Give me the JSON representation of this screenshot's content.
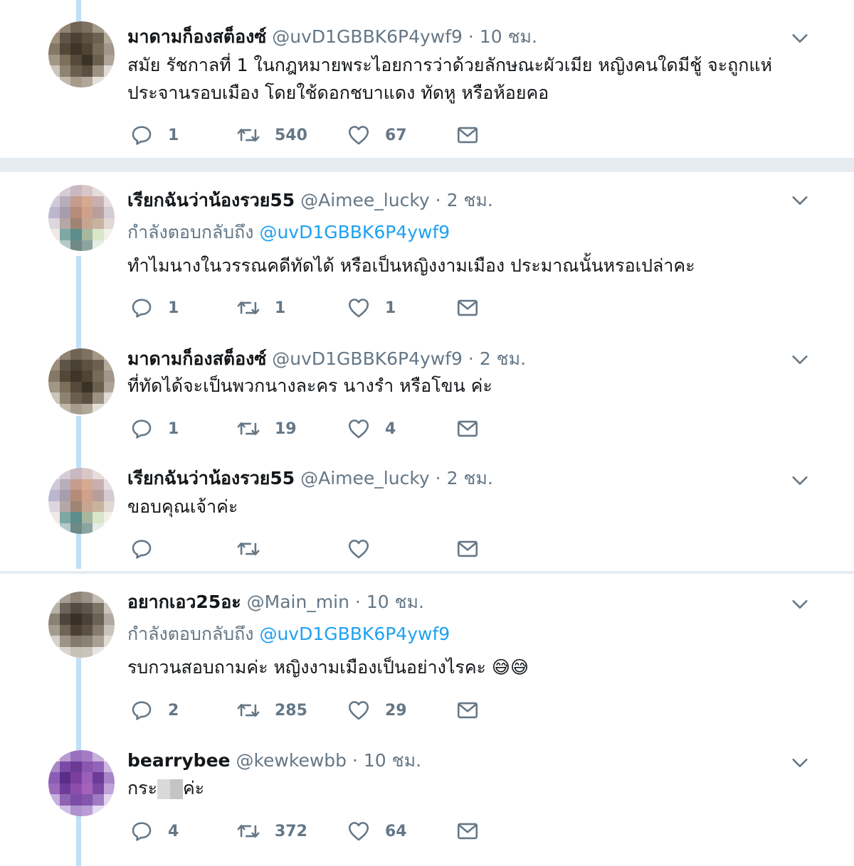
{
  "tweets": [
    {
      "name": "มาดามก็องสต็องซ์",
      "handle": "@uvD1GBBK6P4ywf9",
      "time": "10 ชม.",
      "text": "สมัย รัชกาลที่ 1 ในกฎหมายพระไอยการว่าด้วยลักษณะผัวเมีย หญิงคนใดมีชู้ จะถูกแห่ประจานรอบเมือง โดยใช้ดอกชบาแดง ทัดหู หรือห้อยคอ",
      "replies": "1",
      "retweets": "540",
      "likes": "67"
    },
    {
      "name": "เรียกฉันว่าน้องรวย55",
      "handle": "@Aimee_lucky",
      "time": "2 ชม.",
      "replying_label": "กำลังตอบกลับถึง",
      "replying_to": "@uvD1GBBK6P4ywf9",
      "text": "ทำไมนางในวรรณคดีทัดได้  หรือเป็นหญิงงามเมือง ประมาณนั้นหรอเปล่าคะ",
      "replies": "1",
      "retweets": "1",
      "likes": "1"
    },
    {
      "name": "มาดามก็องสต็องซ์",
      "handle": "@uvD1GBBK6P4ywf9",
      "time": "2 ชม.",
      "text": "ที่ทัดได้จะเป็นพวกนางละคร นางรำ หรือโขน ค่ะ",
      "replies": "1",
      "retweets": "19",
      "likes": "4"
    },
    {
      "name": "เรียกฉันว่าน้องรวย55",
      "handle": "@Aimee_lucky",
      "time": "2 ชม.",
      "text": "ขอบคุณเจ้าค่ะ",
      "replies": "",
      "retweets": "",
      "likes": ""
    },
    {
      "name": "อยากเอว25อะ",
      "handle": "@Main_min",
      "time": "10 ชม.",
      "replying_label": "กำลังตอบกลับถึง",
      "replying_to": "@uvD1GBBK6P4ywf9",
      "text": "รบกวนสอบถามค่ะ หญิงงามเมืองเป็นอย่างไรคะ 😅😅",
      "replies": "2",
      "retweets": "285",
      "likes": "29"
    },
    {
      "name": "bearrybee",
      "handle": "@kewkewbb",
      "time": "10 ชม.",
      "text_before": "กระ",
      "text_after": "ค่ะ",
      "replies": "4",
      "retweets": "372",
      "likes": "64"
    }
  ],
  "separator": "·",
  "icons": {
    "reply": "reply-icon",
    "retweet": "retweet-icon",
    "like": "heart-icon",
    "dm": "envelope-icon",
    "menu": "chevron-down-icon"
  },
  "colors": {
    "link": "#1da1f2",
    "muted": "#657786",
    "thread": "#bfe0f7",
    "divider": "#e6ecf0"
  }
}
